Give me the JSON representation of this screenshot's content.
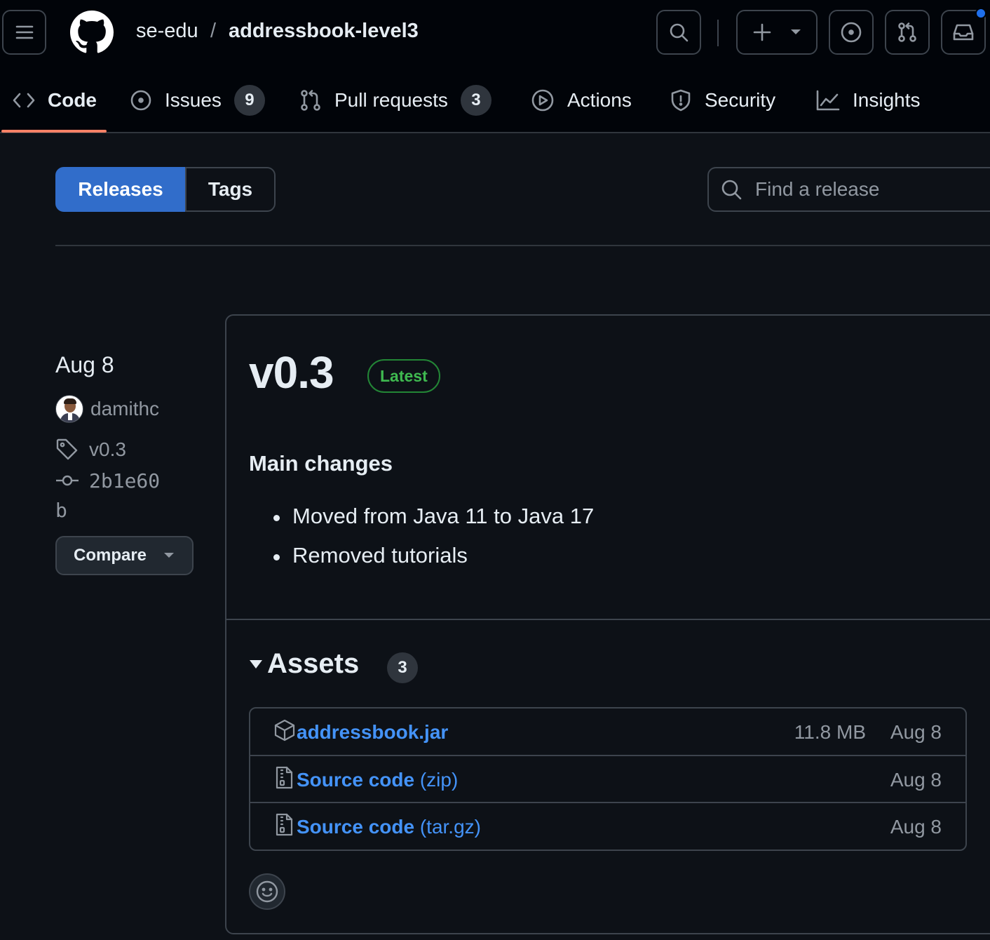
{
  "header": {
    "owner": "se-edu",
    "separator": "/",
    "repo": "addressbook-level3"
  },
  "repo_nav": {
    "tabs": [
      {
        "label": "Code",
        "icon": "code-icon",
        "selected": true
      },
      {
        "label": "Issues",
        "icon": "issue-opened-icon",
        "count": "9"
      },
      {
        "label": "Pull requests",
        "icon": "git-pull-request-icon",
        "count": "3"
      },
      {
        "label": "Actions",
        "icon": "play-icon"
      },
      {
        "label": "Security",
        "icon": "shield-icon"
      },
      {
        "label": "Insights",
        "icon": "graph-icon"
      }
    ]
  },
  "subnav": {
    "releases_label": "Releases",
    "tags_label": "Tags",
    "search_placeholder": "Find a release"
  },
  "release": {
    "date": "Aug 8",
    "author": "damithc",
    "tag": "v0.3",
    "commit_line1": "2b1e60",
    "commit_line2": "b",
    "compare_label": "Compare",
    "title": "v0.3",
    "badge": "Latest",
    "body_heading": "Main changes",
    "body_items": [
      "Moved from Java 11 to Java 17",
      "Removed tutorials"
    ]
  },
  "assets": {
    "title": "Assets",
    "count": "3",
    "items": [
      {
        "name": "addressbook.jar",
        "ext": "",
        "size": "11.8 MB",
        "date": "Aug 8",
        "icon": "package-icon"
      },
      {
        "name": "Source code",
        "ext": " (zip)",
        "size": "",
        "date": "Aug 8",
        "icon": "file-zip-icon"
      },
      {
        "name": "Source code",
        "ext": " (tar.gz)",
        "size": "",
        "date": "Aug 8",
        "icon": "file-zip-icon"
      }
    ]
  },
  "colors": {
    "background": "#0d1117",
    "header_background": "#010409",
    "accent_blue": "#4493f8",
    "selected_button": "#316dca",
    "latest_green": "#3fb950",
    "tab_underline": "#f78166",
    "notification_dot": "#1f6feb"
  }
}
